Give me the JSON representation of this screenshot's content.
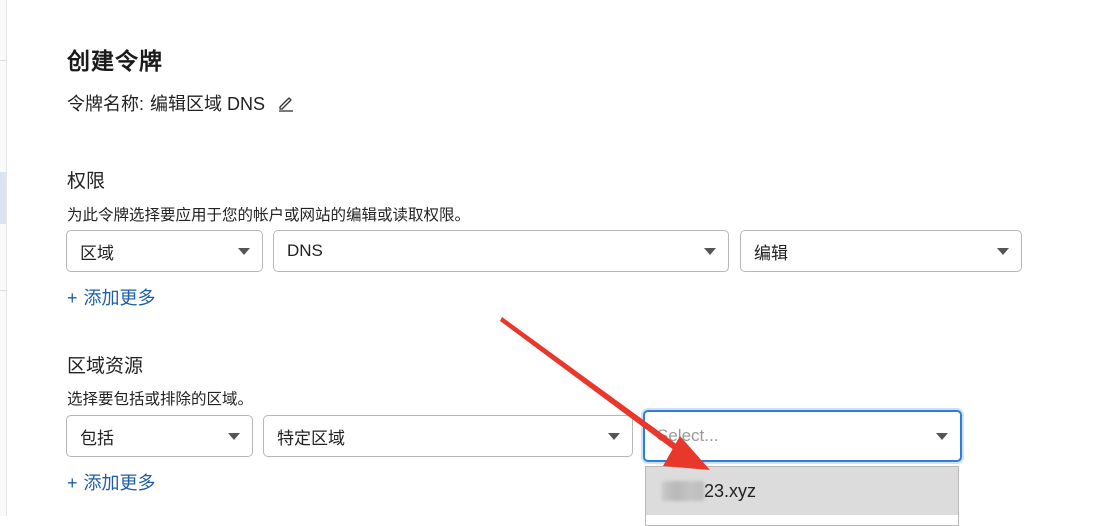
{
  "page": {
    "title": "创建令牌",
    "token_name_label": "令牌名称:",
    "token_name_value": "编辑区域 DNS"
  },
  "permissions": {
    "title": "权限",
    "description": "为此令牌选择要应用于您的帐户或网站的编辑或读取权限。",
    "selects": [
      "区域",
      "DNS",
      "编辑"
    ],
    "add_more": "添加更多"
  },
  "zone_resources": {
    "title": "区域资源",
    "description": "选择要包括或排除的区域。",
    "include_select": "包括",
    "scope_select": "特定区域",
    "zone_select_placeholder": "Select...",
    "add_more": "添加更多",
    "dropdown_options": [
      "23.xyz"
    ]
  },
  "icons": {
    "edit": "pencil-icon",
    "add": "plus-icon",
    "select_caret": "chevron-down-icon",
    "annotation": "red-arrow"
  },
  "colors": {
    "link": "#1d5ea8",
    "focus_border": "#2f7dd8",
    "annotation_arrow": "#e8382c",
    "option_highlight": "#dcdcdc"
  }
}
